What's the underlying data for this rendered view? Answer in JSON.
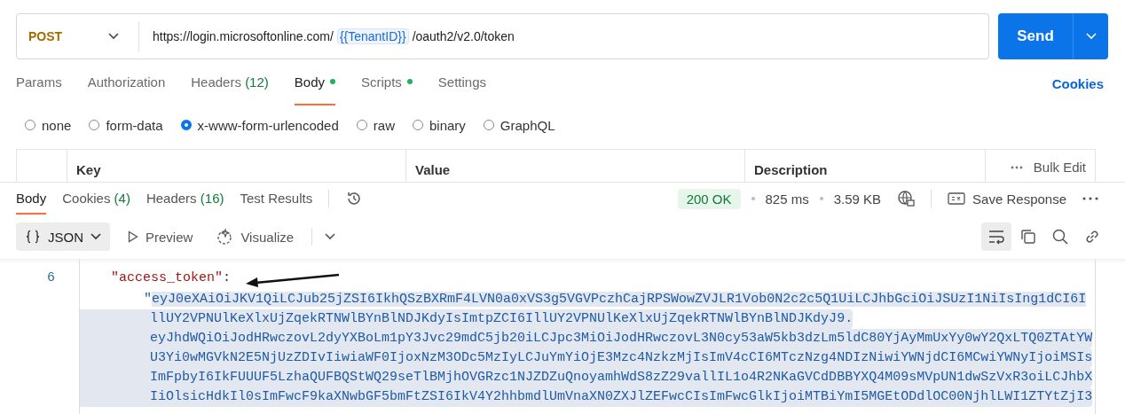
{
  "request": {
    "method": "POST",
    "url_parts": [
      {
        "kind": "text",
        "text": "https://login.microsoftonline.com/"
      },
      {
        "kind": "variable",
        "text": "{{TenantID}}"
      },
      {
        "kind": "text",
        "text": "/oauth2/v2.0/token"
      }
    ],
    "send_label": "Send"
  },
  "request_tabs": [
    {
      "label": "Params",
      "selected": false,
      "dot": false
    },
    {
      "label": "Authorization",
      "selected": false,
      "dot": false
    },
    {
      "label": "Headers",
      "count": "(12)",
      "selected": false,
      "dot": false
    },
    {
      "label": "Body",
      "selected": true,
      "dot": true
    },
    {
      "label": "Scripts",
      "selected": false,
      "dot": true
    },
    {
      "label": "Settings",
      "selected": false,
      "dot": false
    }
  ],
  "cookies_link": "Cookies",
  "body_types": [
    {
      "label": "none",
      "selected": false
    },
    {
      "label": "form-data",
      "selected": false
    },
    {
      "label": "x-www-form-urlencoded",
      "selected": true
    },
    {
      "label": "raw",
      "selected": false
    },
    {
      "label": "binary",
      "selected": false
    },
    {
      "label": "GraphQL",
      "selected": false
    }
  ],
  "params_table": {
    "columns": [
      "Key",
      "Value",
      "Description"
    ],
    "bulk_edit": "Bulk Edit"
  },
  "response_tabs": [
    {
      "label": "Body",
      "selected": true
    },
    {
      "label": "Cookies",
      "count": "(4)",
      "selected": false
    },
    {
      "label": "Headers",
      "count": "(16)",
      "selected": false
    },
    {
      "label": "Test Results",
      "selected": false
    }
  ],
  "response_meta": {
    "status": "200 OK",
    "time": "825 ms",
    "size": "3.59 KB",
    "save_response": "Save Response"
  },
  "viewer": {
    "format": "JSON",
    "preview": "Preview",
    "visualize": "Visualize"
  },
  "code": {
    "lines": [
      {
        "number": "6",
        "parts": [
          {
            "kind": "key",
            "text": "\"access_token\""
          },
          {
            "kind": "punct",
            "text": ":"
          }
        ]
      }
    ],
    "token": {
      "quote": "\"",
      "selected": true,
      "lines": [
        "eyJ0eXAiOiJKV1QiLCJub25jZSI6IkhQSzBXRmF4LVN0a0xVS3g5VGVPczhCajRPSWowZVJLR1Vob0N2c2c5Q1UiLCJhbGciOiJSUzI1NiIsIng1dCI6I",
        "llUY2VPNUlKeXlxUjZqekRTNWlBYnBlNDJKdyIsImtpZCI6IllUY2VPNUlKeXlxUjZqekRTNWlBYnBlNDJKdyJ9.",
        "eyJhdWQiOiJodHRwczovL2dyYXBoLm1pY3Jvc29mdC5jb20iLCJpc3MiOiJodHRwczovL3N0cy53aW5kb3dzLm5ldC80YjAyMmUxYy0wY2QxLTQ0ZTAtYW",
        "U3Yi0wMGVkN2E5NjUzZDIvIiwiaWF0IjoxNzM3ODc5MzIyLCJuYmYiOjE3Mzc4NzkzMjIsImV4cCI6MTczNzg4NDIzNiwiYWNjdCI6MCwiYWNyIjoiMSIs",
        "ImFpbyI6IkFUUUF5LzhaQUFBQStWQ29seTlBMjhOVGRzc1NJZDZuQnoyamhWdS8zZ29vallIL1o4R2NKaGVCdDBBYXQ4M09sMVpUN1dwSzVxR3oiLCJhbX",
        "IiOlsicHdkIl0sImFwcF9kaXNwbGF5bmFtZSI6IkV4Y2hhbmdlUmVnaXN0ZXJlZEFwcCIsImFwcGlkIjoiMTBiYmI5MGEtODdlOC00NjhlLWI1ZTYtZjI3"
      ]
    }
  }
}
